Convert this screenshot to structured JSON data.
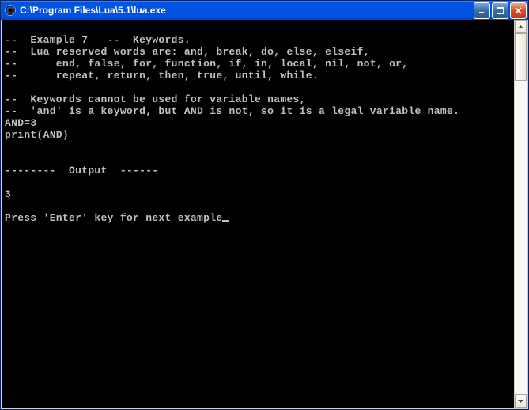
{
  "window": {
    "title": "C:\\Program Files\\Lua\\5.1\\lua.exe",
    "icon_name": "console-icon"
  },
  "buttons": {
    "minimize_symbol": "_",
    "maximize_symbol": "□",
    "close_symbol": "×"
  },
  "console": {
    "lines": [
      "",
      "--  Example 7   --  Keywords.",
      "--  Lua reserved words are: and, break, do, else, elseif,",
      "--      end, false, for, function, if, in, local, nil, not, or,",
      "--      repeat, return, then, true, until, while.",
      "",
      "--  Keywords cannot be used for variable names,",
      "--  'and' is a keyword, but AND is not, so it is a legal variable name.",
      "AND=3",
      "print(AND)",
      "",
      "",
      "--------  Output  ------",
      "",
      "3",
      "",
      "Press 'Enter' key for next example"
    ],
    "cursor_after_last": true
  }
}
